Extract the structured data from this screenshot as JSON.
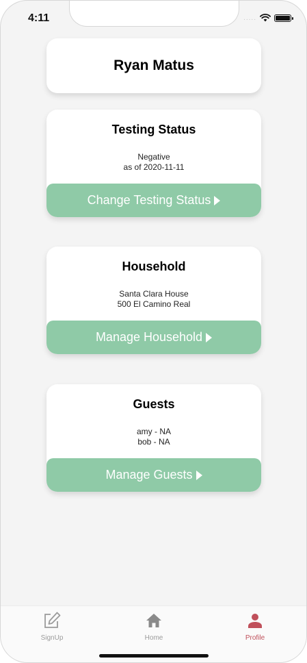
{
  "status_bar": {
    "time": "4:11",
    "signal_dots": "....."
  },
  "profile": {
    "name": "Ryan Matus"
  },
  "testing": {
    "title": "Testing Status",
    "line1": "Negative",
    "line2": "as of 2020-11-11",
    "button_label": "Change Testing Status"
  },
  "household": {
    "title": "Household",
    "line1": "Santa Clara House",
    "line2": "500 El Camino Real",
    "button_label": "Manage Household"
  },
  "guests": {
    "title": "Guests",
    "line1": "amy - NA",
    "line2": "bob - NA",
    "button_label": "Manage Guests"
  },
  "tabs": [
    {
      "label": "SignUp",
      "icon": "edit-icon"
    },
    {
      "label": "Home",
      "icon": "home-icon"
    },
    {
      "label": "Profile",
      "icon": "person-icon",
      "active": true
    }
  ],
  "colors": {
    "button_green": "#8fcaa7",
    "active_tab": "#c0505b",
    "inactive_tab": "#9b9b9b",
    "background": "#f4f4f4"
  }
}
